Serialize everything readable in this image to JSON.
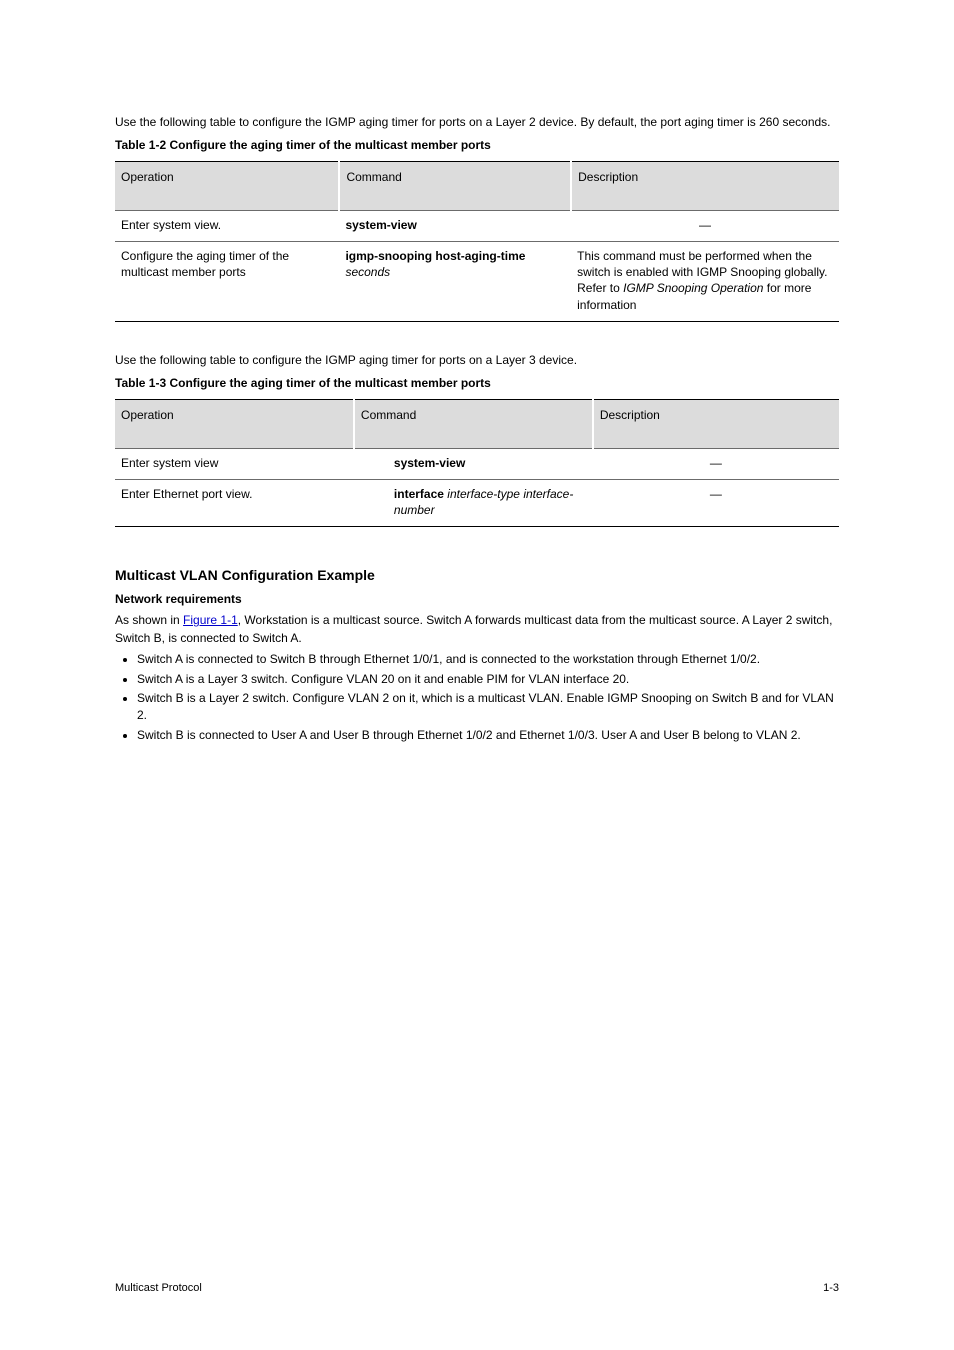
{
  "intro1": "Use the following table to configure the IGMP aging timer for ports on a Layer 2 device. By default, the port aging timer is 260 seconds.",
  "table2": {
    "caption": "Table 1-2 Configure the aging timer of the multicast member ports",
    "headers": [
      "Operation",
      "Command",
      "Description"
    ],
    "rows": [
      [
        "Enter system view.",
        "system-view",
        "—"
      ],
      [
        "Configure the aging timer of the multicast member ports",
        "igmp-snooping host-aging-time seconds",
        "This command must be performed when the switch is enabled with IGMP Snooping globally. Refer to IGMP Snooping Operation for more information"
      ]
    ]
  },
  "intro2": "Use the following table to configure the IGMP aging timer for ports on a Layer 3 device.",
  "table3": {
    "caption": "Table 1-3 Configure the aging timer of the multicast member ports",
    "headers": [
      "Operation",
      "Command",
      "Description"
    ],
    "rows": [
      [
        "Enter system view",
        "system-view",
        "—"
      ],
      [
        "Enter Ethernet port view.",
        "interface interface-type interface-number",
        "—"
      ]
    ]
  },
  "config_example": {
    "heading": "Multicast VLAN Configuration Example",
    "netreq_heading": "Network requirements",
    "line1_pre": "As shown in ",
    "line1_link": "Figure 1-1",
    "line1_post": ", Workstation is a multicast source. Switch A forwards multicast data from the multicast source. A Layer 2 switch, Switch B, is connected to Switch A.",
    "bullets": [
      "Switch A is connected to Switch B through Ethernet 1/0/1, and is connected to the workstation through Ethernet 1/0/2.",
      "Switch A is a Layer 3 switch. Configure VLAN 20 on it and enable PIM for VLAN interface 20.",
      "Switch B is a Layer 2 switch. Configure VLAN 2 on it, which is a multicast VLAN. Enable IGMP Snooping on Switch B and for VLAN 2.",
      "Switch B is connected to User A and User B through Ethernet 1/0/2 and Ethernet 1/0/3. User A and User B belong to VLAN 2."
    ]
  },
  "footer": "Multicast Protocol",
  "pagenum": "1-3"
}
